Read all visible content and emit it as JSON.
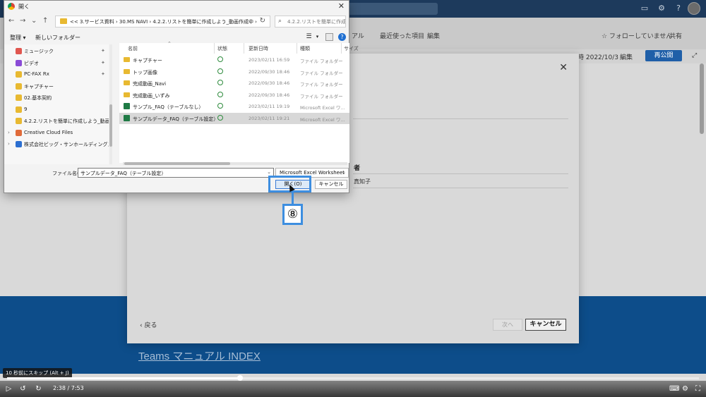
{
  "dialog": {
    "title": "開く",
    "address": "<< 3.サービス資料 › 30.MS NAVI › 4.2.2.リストを簡単に作成しよう_動画作成中 ›",
    "search_placeholder": "4.2.2.リストを簡単に作成しよう...",
    "toolbar": {
      "organize": "整理 ▾",
      "new_folder": "新しいフォルダー"
    },
    "nav_items": [
      {
        "label": "ミュージック",
        "color": "#e0564f",
        "pinned": true
      },
      {
        "label": "ビデオ",
        "color": "#8a4bd6",
        "pinned": true
      },
      {
        "label": "PC-FAX Rx",
        "color": "#e8b931",
        "pinned": true
      },
      {
        "label": "キャプチャー",
        "color": "#e8b931",
        "pinned": false
      },
      {
        "label": "02.基本契約",
        "color": "#e8b931",
        "pinned": false
      },
      {
        "label": "9",
        "color": "#e8b931",
        "pinned": false
      },
      {
        "label": "4.2.2.リストを簡単に作成しよう_動画作成中",
        "color": "#e8b931",
        "pinned": false
      },
      {
        "label": "Creative Cloud Files",
        "color": "#e06b3a",
        "pinned": false
      },
      {
        "label": "株式会社ビッグ・サンホールディングス",
        "color": "#2c6fd1",
        "pinned": false
      }
    ],
    "columns": {
      "name": "名前",
      "status": "状態",
      "date": "更新日時",
      "type": "種類",
      "size": "サイズ"
    },
    "files": [
      {
        "name": "キャプチャー",
        "icon": "folder",
        "date": "2023/02/11 16:59",
        "type": "ファイル フォルダー",
        "selected": false
      },
      {
        "name": "トップ画像",
        "icon": "folder",
        "date": "2022/09/30 18:46",
        "type": "ファイル フォルダー",
        "selected": false
      },
      {
        "name": "完成動画_Navi",
        "icon": "folder",
        "date": "2022/09/30 18:46",
        "type": "ファイル フォルダー",
        "selected": false
      },
      {
        "name": "完成動画_いずみ",
        "icon": "folder",
        "date": "2022/09/30 18:46",
        "type": "ファイル フォルダー",
        "selected": false
      },
      {
        "name": "サンプル_FAQ（テーブルなし）",
        "icon": "excel",
        "date": "2023/02/11 19:19",
        "type": "Microsoft Excel ワ...",
        "selected": false
      },
      {
        "name": "サンプルデータ_FAQ（テーブル設定）",
        "icon": "excel",
        "date": "2023/02/11 19:21",
        "type": "Microsoft Excel ワ...",
        "selected": true
      }
    ],
    "filename_label": "ファイル名(N):",
    "filename_value": "サンプルデータ_FAQ（テーブル設定）",
    "filetype_value": "Microsoft Excel Worksheet",
    "open_label": "開く(O)",
    "cancel_label": "キャンセル"
  },
  "annotation": {
    "step": "⑧"
  },
  "background": {
    "nav_items": [
      "アル",
      "最近使った項目",
      "編集"
    ],
    "follow_label": "☆ フォローしていません",
    "share_label": "共有",
    "date_label": "時 2022/10/3",
    "edit_label": "編集",
    "republish_label": "再公開",
    "hero_link": "Teams マニュアル INDEX"
  },
  "modal": {
    "col_head": "者",
    "cell": "真知子",
    "back_label": "戻る",
    "next_label": "次へ",
    "cancel_label": "キャンセル"
  },
  "player": {
    "tooltip": "10 秒前にスキップ (Alt + J)",
    "time": "2:38 / 7:53",
    "progress": 0.337
  },
  "colors": {
    "accent": "#3d8ee0",
    "hero": "#0d4d8a",
    "selected_row": "#d8d8d8"
  }
}
